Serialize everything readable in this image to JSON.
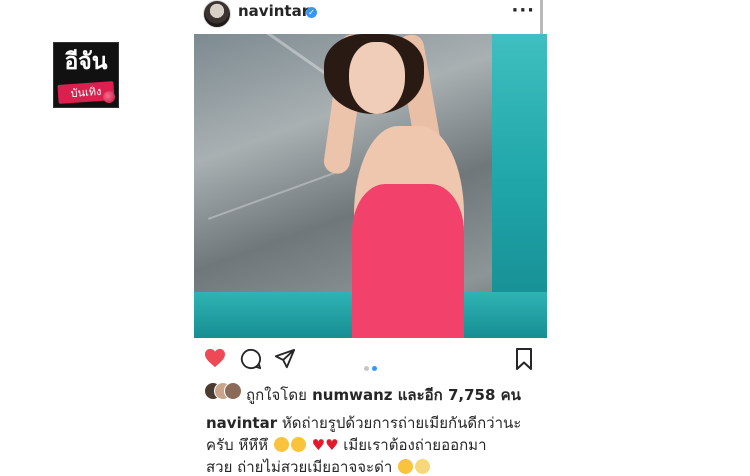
{
  "watermark": {
    "main_text": "อีจัน",
    "sub_text": "บันเทิง"
  },
  "post": {
    "username": "navintar",
    "verified": true,
    "more_label": "···",
    "likes": {
      "prefix": "ถูกใจโดย",
      "liker": "numwanz",
      "suffix": "และอีก 7,758 คน"
    },
    "caption": {
      "username": "navintar",
      "line1": "หัดถ่ายรูปด้วยการถ่ายเมียกันดีกว่านะ",
      "line2_a": "ครับ หึหึหึ",
      "line2_b": "เมียเราต้องถ่ายออกมา",
      "line3_a": "สวย ถ่ายไม่สวยเมียอาจจะด่า",
      "emojis": [
        "squinting-tongue",
        "squinting-tongue",
        "heart",
        "heart",
        "hushed-face",
        "screaming-face"
      ]
    },
    "carousel": {
      "total": 2,
      "active": 2
    }
  },
  "colors": {
    "like_red": "#ed4956",
    "active_dot": "#3897f0",
    "inactive_dot": "#c7c7c7",
    "verified_blue": "#3897f0",
    "swimsuit_pink": "#f2416b"
  }
}
